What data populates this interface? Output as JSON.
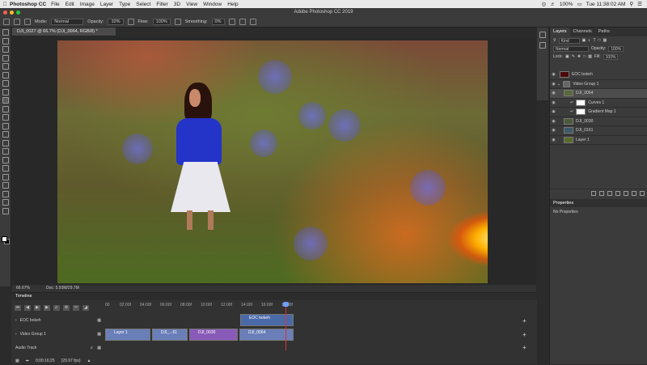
{
  "menubar": {
    "app_name": "Photoshop CC",
    "menus": [
      "File",
      "Edit",
      "Image",
      "Layer",
      "Type",
      "Select",
      "Filter",
      "3D",
      "View",
      "Window",
      "Help"
    ],
    "battery": "100%",
    "clock": "Tue 11:38:02 AM"
  },
  "window": {
    "title": "Adobe Photoshop CC 2019"
  },
  "options": {
    "mode_label": "Mode:",
    "mode_value": "Normal",
    "opacity_label": "Opacity:",
    "opacity_value": "10%",
    "flow_label": "Flow:",
    "flow_value": "100%",
    "smoothing_label": "Smoothing:",
    "smoothing_value": "0%"
  },
  "document": {
    "tab_title": "DJI_0027 @ 66.7% (DJI_0064, RGB/8) *",
    "zoom": "66.67%",
    "doc_size": "Doc: 5.93M/29.7M"
  },
  "layers_panel": {
    "tabs": [
      "Layers",
      "Channels",
      "Paths"
    ],
    "filter_label": "Kind",
    "blend_mode": "Normal",
    "opacity_label": "Opacity:",
    "opacity_value": "100%",
    "lock_label": "Lock:",
    "fill_label": "Fill:",
    "fill_value": "100%",
    "layers": [
      {
        "name": "EOC bokeh"
      },
      {
        "name": "Video Group 1"
      },
      {
        "name": "DJI_0064"
      },
      {
        "name": "Curves 1"
      },
      {
        "name": "Gradient Map 1"
      },
      {
        "name": "DJI_0030"
      },
      {
        "name": "DJI_0161"
      },
      {
        "name": "Layer 1"
      }
    ]
  },
  "properties": {
    "title": "Properties",
    "body": "No Properties"
  },
  "timeline": {
    "title": "Timeline",
    "ruler": [
      "00",
      "02:00f",
      "04:00f",
      "06:00f",
      "08:00f",
      "10:00f",
      "12:00f",
      "14:00f",
      "16:00f",
      "18:00f"
    ],
    "tracks": [
      "EOC bokeh",
      "Video Group 1",
      "Audio Track"
    ],
    "clips": {
      "eoc": "EOC bokeh",
      "layer1": "Layer 1",
      "dji61": "DJI_...61",
      "dji30": "DJI_0030",
      "dji64": "DJI_0064"
    },
    "timecode": "0;00;16;25",
    "fps": "(29.97 fps)"
  },
  "colors": {
    "accent": "#6aa0ff",
    "playhead": "#e03030",
    "clip_video": "#6a7fb8",
    "clip_purple": "#8a5ab8"
  }
}
